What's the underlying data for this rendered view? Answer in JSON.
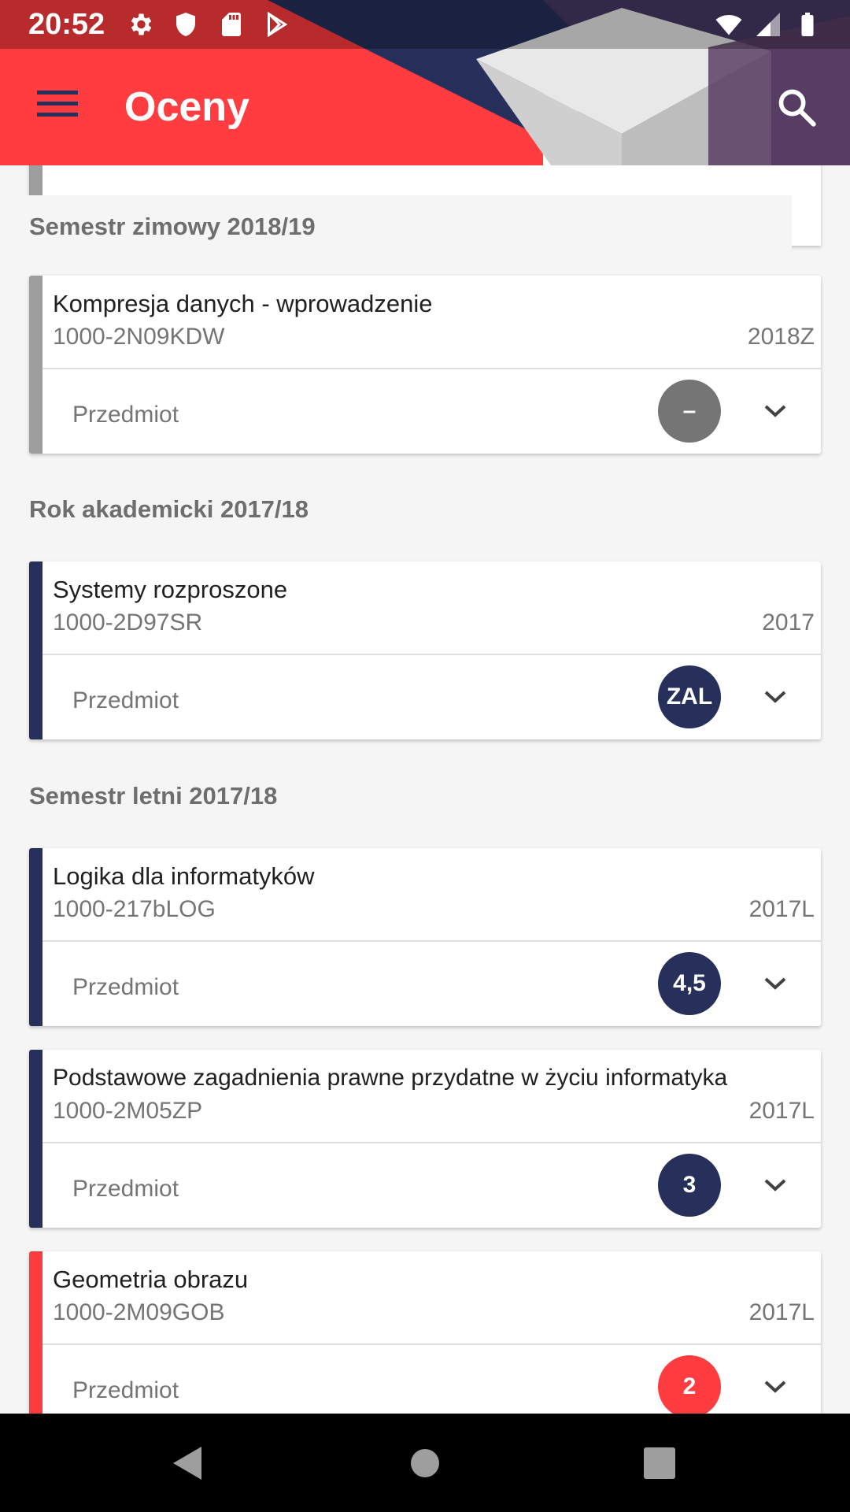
{
  "status_bar": {
    "time": "20:52",
    "left_icons": [
      "gear-icon",
      "shield-icon",
      "sd-card-icon",
      "play-store-icon"
    ],
    "right_icons": [
      "wifi-icon",
      "signal-icon",
      "battery-icon"
    ]
  },
  "app_bar": {
    "title": "Oceny",
    "menu_icon": "hamburger-menu-icon",
    "search_icon": "search-icon",
    "colors": {
      "primary": "#ff3c3f",
      "navy": "#26305a",
      "gray_accent": "#9e9e9e"
    }
  },
  "sections": [
    {
      "title": "Semestr zimowy 2018/19",
      "courses": [
        {
          "name": "Kompresja danych - wprowadzenie",
          "code": "1000-2N09KDW",
          "term": "2018Z",
          "type": "Przedmiot",
          "grade": "–",
          "accent": "#9e9e9e",
          "grade_color": "#757575"
        }
      ]
    },
    {
      "title": "Rok akademicki 2017/18",
      "courses": [
        {
          "name": "Systemy rozproszone",
          "code": "1000-2D97SR",
          "term": "2017",
          "type": "Przedmiot",
          "grade": "ZAL",
          "accent": "#26305a",
          "grade_color": "#26305a"
        }
      ]
    },
    {
      "title": "Semestr letni 2017/18",
      "courses": [
        {
          "name": "Logika dla informatyków",
          "code": "1000-217bLOG",
          "term": "2017L",
          "type": "Przedmiot",
          "grade": "4,5",
          "accent": "#26305a",
          "grade_color": "#26305a"
        },
        {
          "name": "Podstawowe zagadnienia prawne przydatne w życiu informatyka",
          "code": "1000-2M05ZP",
          "term": "2017L",
          "type": "Przedmiot",
          "grade": "3",
          "accent": "#26305a",
          "grade_color": "#26305a"
        },
        {
          "name": "Geometria obrazu",
          "code": "1000-2M09GOB",
          "term": "2017L",
          "type": "Przedmiot",
          "grade": "2",
          "accent": "#ff3c3f",
          "grade_color": "#ff3c3f"
        }
      ]
    }
  ],
  "nav_bar": {
    "back_icon": "back-triangle-icon",
    "home_icon": "home-circle-icon",
    "recents_icon": "recents-square-icon"
  }
}
